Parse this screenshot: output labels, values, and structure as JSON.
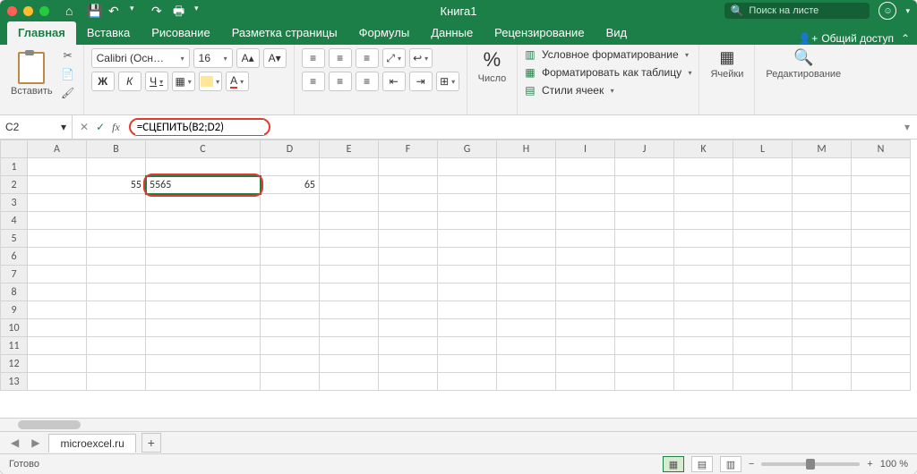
{
  "titlebar": {
    "title": "Книга1",
    "search_placeholder": "Поиск на листе"
  },
  "tabs": {
    "items": [
      "Главная",
      "Вставка",
      "Рисование",
      "Разметка страницы",
      "Формулы",
      "Данные",
      "Рецензирование",
      "Вид"
    ],
    "active": 0,
    "share": "Общий доступ"
  },
  "ribbon": {
    "paste": "Вставить",
    "font_name": "Calibri (Осн…",
    "font_size": "16",
    "bold": "Ж",
    "italic": "К",
    "underline": "Ч",
    "number_group": "Число",
    "cond_fmt": "Условное форматирование",
    "as_table": "Форматировать как таблицу",
    "cell_styles": "Стили ячеек",
    "cells": "Ячейки",
    "editing": "Редактирование",
    "percent": "%"
  },
  "formula": {
    "cell_ref": "C2",
    "fx": "fx",
    "value": "=СЦЕПИТЬ(B2;D2)"
  },
  "grid": {
    "cols": [
      "A",
      "B",
      "C",
      "D",
      "E",
      "F",
      "G",
      "H",
      "I",
      "J",
      "K",
      "L",
      "M",
      "N"
    ],
    "rows": 13,
    "data": {
      "B2": "55",
      "C2": "5565",
      "D2": "65"
    },
    "selected": "C2"
  },
  "sheets": {
    "active": "microexcel.ru"
  },
  "status": {
    "ready": "Готово",
    "zoom": "100 %"
  }
}
